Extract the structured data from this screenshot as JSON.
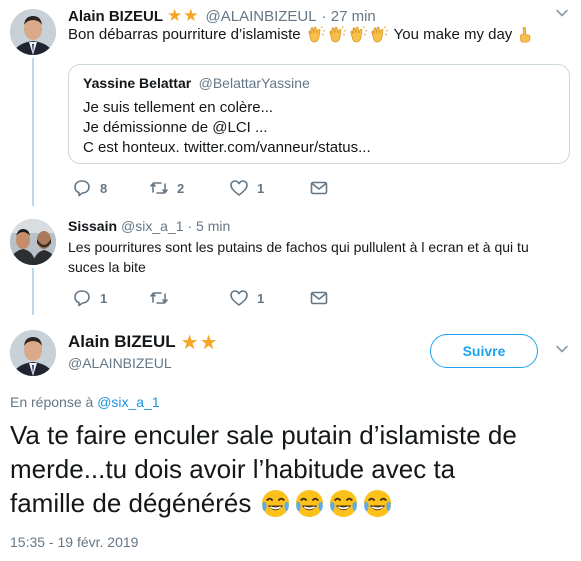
{
  "tweet1": {
    "name": "Alain BIZEUL",
    "stars": "★★",
    "handle": "@ALAINBIZEUL",
    "time": "· 27 min",
    "text_before": "Bon débarras pourriture d’islamiste",
    "emoji": [
      "clapping-hands",
      "clapping-hands",
      "clapping-hands",
      "clapping-hands"
    ],
    "text_after": "You make my day",
    "end_emoji": "pointing-up-hand",
    "quote": {
      "name": "Yassine Belattar",
      "handle": "@BelattarYassine",
      "lines": [
        "Je suis tellement en colère...",
        "Je démissionne de @LCI ...",
        "C est honteux. twitter.com/vanneur/status..."
      ]
    },
    "actions": {
      "reply_count": "8",
      "retweet_count": "2",
      "like_count": "1"
    }
  },
  "tweet2": {
    "name": "Sissain",
    "handle": "@six_a_1",
    "time": "· 5 min",
    "lines": [
      "Les pourritures sont les putains de fachos qui pullulent à l ecran et à qui tu",
      "suces la bite"
    ],
    "actions": {
      "reply_count": "1",
      "retweet_count": "",
      "like_count": "1"
    }
  },
  "main": {
    "name": "Alain BIZEUL",
    "stars": "★★",
    "handle": "@ALAINBIZEUL",
    "follow_label": "Suivre",
    "reply_prefix": "En réponse à",
    "reply_handle": "@six_a_1",
    "lines": [
      "Va te faire enculer sale putain d’islamiste de",
      "merde...tu dois avoir l’habitude avec ta",
      "famille de dégénérés"
    ],
    "emoji": [
      "face-with-tears-of-joy",
      "face-with-tears-of-joy",
      "face-with-tears-of-joy",
      "face-with-tears-of-joy"
    ],
    "timestamp": "15:35 - 19 févr. 2019"
  },
  "colors": {
    "accent": "#1da1f2",
    "secondary": "#657786",
    "thread": "#b9d8f0",
    "star": "#f5a623"
  }
}
